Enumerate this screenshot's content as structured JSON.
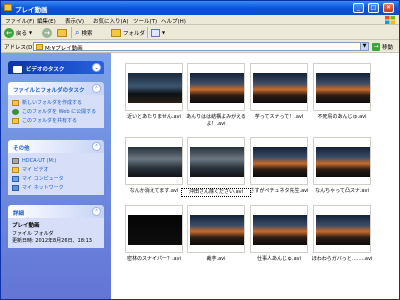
{
  "window": {
    "title": "プレイ動画"
  },
  "titlebar_buttons": {
    "minimize": "_",
    "maximize": "□",
    "close": "✕"
  },
  "menu": [
    "ファイル(F)",
    "編集(E)",
    "表示(V)",
    "お気に入り(A)",
    "ツール(T)",
    "ヘルプ(H)"
  ],
  "toolbar": {
    "back": "戻る",
    "search": "検索",
    "folders": "フォルダ"
  },
  "address": {
    "label": "アドレス(D)",
    "path": "M:¥プレイ動画",
    "go": "移動"
  },
  "sidebar": {
    "video_tasks": {
      "title": "ビデオのタスク"
    },
    "file_tasks": {
      "title": "ファイルとフォルダのタスク",
      "items": [
        "新しいフォルダを作成する",
        "このフォルダを Web に公開する",
        "このフォルダを共有する"
      ]
    },
    "other_places": {
      "title": "その他",
      "items": [
        "HDCA-UT (M:)",
        "マイ ビデオ",
        "マイ コンピュータ",
        "マイ ネットワーク"
      ]
    },
    "details": {
      "title": "詳細",
      "name": "プレイ動画",
      "type": "ファイル フォルダ",
      "modified": "更新日時: 2012年8月26日、18:13"
    }
  },
  "files": [
    {
      "name": "近いとあたりません.avi",
      "theme": "dark-sky"
    },
    {
      "name": "あんりはは結構よみがえるよ！.avi",
      "theme": "sunset"
    },
    {
      "name": "芋ってスナって！.avi",
      "theme": "sunset"
    },
    {
      "name": "不死鳥のあんじゅ.avi",
      "theme": "sunset"
    },
    {
      "name": "なんか消えてます.avi",
      "theme": "menu"
    },
    {
      "name": "沖田さん隊ください.avi",
      "theme": "menu",
      "selected": true
    },
    {
      "name": "さすがペチュネタ先生.avi",
      "theme": "sunset"
    },
    {
      "name": "なんちゃって凸スナ.avi",
      "theme": "sunset"
    },
    {
      "name": "密林のスナイパー？.avi",
      "theme": "black"
    },
    {
      "name": "裁芋.avi",
      "theme": "sunset"
    },
    {
      "name": "仕事人あんじゅ.avi",
      "theme": "sunset"
    },
    {
      "name": "ほわわらガバっと……..avi",
      "theme": "sunset"
    }
  ],
  "colors": {
    "accent": "#0855dd",
    "sidebar_top": "#7ba2e7",
    "sidebar_bottom": "#6375d6",
    "task_link": "#215dc6"
  }
}
